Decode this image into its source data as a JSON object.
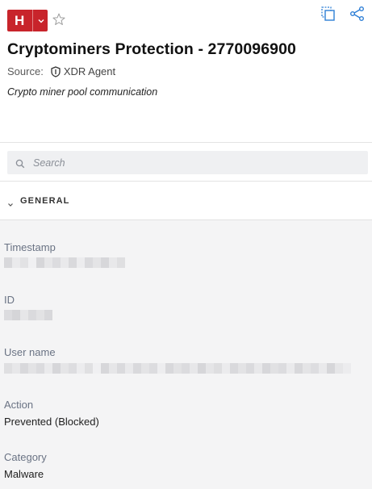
{
  "header": {
    "severity_letter": "H",
    "title": "Cryptominers Protection - 2770096900",
    "source_label": "Source:",
    "source_value": "XDR Agent",
    "description": "Crypto miner pool communication"
  },
  "search": {
    "placeholder": "Search"
  },
  "section": {
    "title": "GENERAL"
  },
  "fields": {
    "timestamp_label": "Timestamp",
    "id_label": "ID",
    "username_label": "User name",
    "action_label": "Action",
    "action_value": "Prevented (Blocked)",
    "category_label": "Category",
    "category_value": "Malware"
  },
  "colors": {
    "severity_high": "#c8242b",
    "accent_icon": "#2e7fd6",
    "label_text": "#6a7384",
    "fields_bg": "#f4f4f5"
  },
  "icons": [
    "chevron-down-icon",
    "star-icon",
    "copy-icon",
    "share-icon",
    "shield-icon",
    "search-icon"
  ]
}
